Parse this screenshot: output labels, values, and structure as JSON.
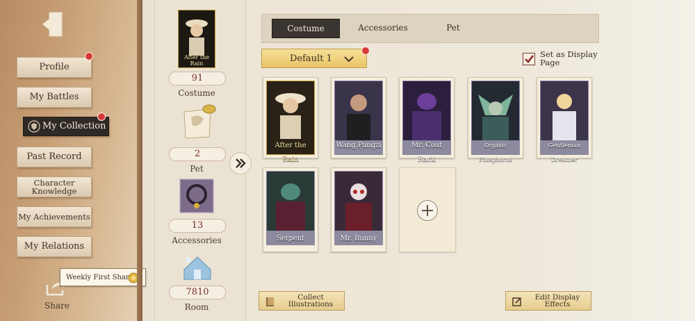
{
  "sidebar": {
    "items": [
      {
        "label": "Profile",
        "badge": true
      },
      {
        "label": "My Battles",
        "badge": false
      },
      {
        "label": "My Collection",
        "badge": true,
        "active": true
      },
      {
        "label": "Past Record",
        "badge": false
      },
      {
        "label": "Character Knowledge",
        "badge": false
      },
      {
        "label": "My Achievements",
        "badge": false
      },
      {
        "label": "My Relations",
        "badge": false
      }
    ],
    "share_label": "Share",
    "tooltip": "Weekly First Share"
  },
  "left_panel": {
    "featured_card_label": "After the Rain",
    "stats": [
      {
        "value": "91",
        "label": "Costume"
      },
      {
        "value": "2",
        "label": "Pet"
      },
      {
        "value": "13",
        "label": "Accessories"
      },
      {
        "value": "7810",
        "label": "Room"
      }
    ]
  },
  "tabs": [
    "Costume",
    "Accessories",
    "Pet"
  ],
  "dropdown": {
    "selected": "Default 1"
  },
  "display_page": {
    "label": "Set as Display Page",
    "checked": true
  },
  "cards": [
    {
      "name": "After the Rain",
      "tier": "gold"
    },
    {
      "name": "Wang Pangzi",
      "tier": "purple"
    },
    {
      "name": "Mr. Coat Rack",
      "tier": "purple"
    },
    {
      "name": "Organic Phosphorus",
      "tier": "purple"
    },
    {
      "name": "Gentleman Dreamer",
      "tier": "purple"
    },
    {
      "name": "Serpent",
      "tier": "purple"
    },
    {
      "name": "Mr. Bunny",
      "tier": "purple"
    }
  ],
  "bottom": {
    "collect_label": "Collect Illustrations",
    "edit_label": "Edit Display Effects"
  },
  "colors": {
    "accent_red": "#d8383a",
    "gold": "#e9c467",
    "dark": "#2f2a25"
  }
}
